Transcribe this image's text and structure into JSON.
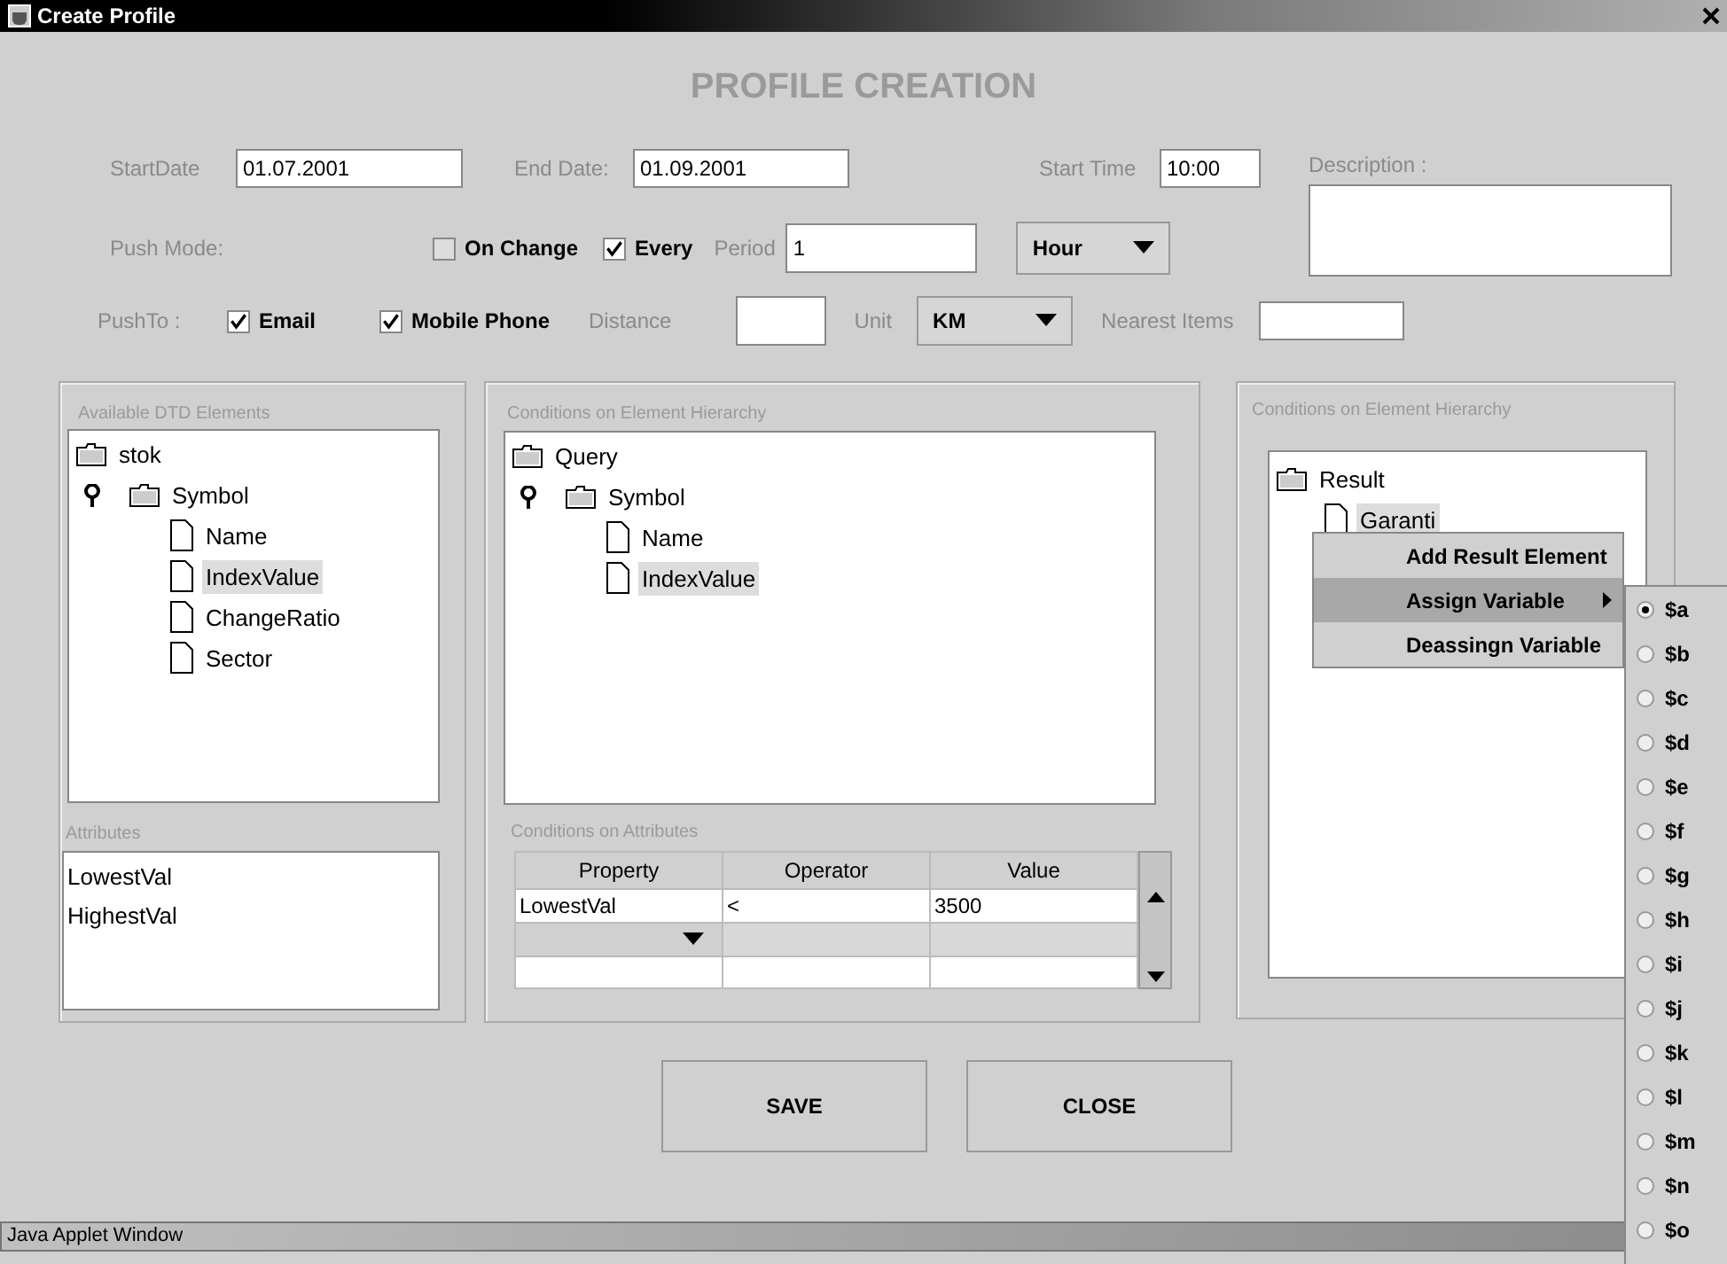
{
  "window": {
    "title": "Create Profile"
  },
  "heading": "PROFILE CREATION",
  "start_date": {
    "label": "StartDate",
    "value": "01.07.2001"
  },
  "end_date": {
    "label": "End Date:",
    "value": "01.09.2001"
  },
  "start_time": {
    "label": "Start Time",
    "value": "10:00"
  },
  "description": {
    "label": "Description :"
  },
  "push_mode": {
    "label": "Push Mode:",
    "options": [
      {
        "label": "On Change",
        "checked": false
      },
      {
        "label": "Every",
        "checked": true
      }
    ],
    "period": {
      "label": "Period",
      "value": "1"
    },
    "period_unit": {
      "value": "Hour"
    }
  },
  "push_to": {
    "label": "PushTo :",
    "options": [
      {
        "label": "Email",
        "checked": true
      },
      {
        "label": "Mobile Phone",
        "checked": true
      }
    ],
    "distance": {
      "label": "Distance"
    },
    "unit": {
      "label": "Unit",
      "value": "KM"
    },
    "nearest_items": {
      "label": "Nearest Items"
    }
  },
  "dtd_panel": {
    "title": "Available DTD Elements",
    "tree": [
      {
        "label": "stok",
        "kind": "folder",
        "selected": false,
        "children": [
          {
            "label": "Symbol",
            "kind": "folder",
            "expanded": true,
            "selected": false,
            "children": [
              {
                "label": "Name",
                "kind": "leaf",
                "selected": false
              },
              {
                "label": "IndexValue",
                "kind": "leaf",
                "selected": true
              },
              {
                "label": "ChangeRatio",
                "kind": "leaf",
                "selected": false
              },
              {
                "label": "Sector",
                "kind": "leaf",
                "selected": false
              }
            ]
          }
        ]
      }
    ],
    "attributes": {
      "title": "Attributes",
      "items": [
        "LowestVal",
        "HighestVal"
      ]
    }
  },
  "hierarchy_panel": {
    "title": "Conditions on Element Hierarchy",
    "tree": [
      {
        "label": "Query",
        "kind": "folder",
        "selected": false,
        "children": [
          {
            "label": "Symbol",
            "kind": "folder",
            "expanded": true,
            "selected": false,
            "children": [
              {
                "label": "Name",
                "kind": "leaf",
                "selected": false
              },
              {
                "label": "IndexValue",
                "kind": "leaf",
                "selected": true
              }
            ]
          }
        ]
      }
    ],
    "attribute_conditions": {
      "title": "Conditions on Attributes",
      "columns": [
        "Property",
        "Operator",
        "Value"
      ],
      "rows": [
        {
          "kind": "text",
          "cells": [
            "LowestVal",
            "<",
            "3500"
          ]
        },
        {
          "kind": "editing",
          "cells": []
        },
        {
          "kind": "empty",
          "cells": []
        }
      ]
    }
  },
  "result_panel": {
    "title": "Conditions on Element Hierarchy",
    "tree": [
      {
        "label": "Result",
        "kind": "folder",
        "selected": false,
        "children": [
          {
            "label": "Garanti",
            "kind": "leaf",
            "selected": true
          }
        ]
      }
    ]
  },
  "context_menu": {
    "items": [
      {
        "label": "Add Result Element",
        "selected": false,
        "submenu": false
      },
      {
        "label": "Assign Variable",
        "selected": true,
        "submenu": true
      },
      {
        "label": "Deassingn Variable",
        "selected": false,
        "submenu": false
      }
    ]
  },
  "variable_menu": {
    "items": [
      {
        "label": "$a",
        "selected": true
      },
      {
        "label": "$b",
        "selected": false
      },
      {
        "label": "$c",
        "selected": false
      },
      {
        "label": "$d",
        "selected": false
      },
      {
        "label": "$e",
        "selected": false
      },
      {
        "label": "$f",
        "selected": false
      },
      {
        "label": "$g",
        "selected": false
      },
      {
        "label": "$h",
        "selected": false
      },
      {
        "label": "$i",
        "selected": false
      },
      {
        "label": "$j",
        "selected": false
      },
      {
        "label": "$k",
        "selected": false
      },
      {
        "label": "$l",
        "selected": false
      },
      {
        "label": "$m",
        "selected": false
      },
      {
        "label": "$n",
        "selected": false
      },
      {
        "label": "$o",
        "selected": false
      }
    ]
  },
  "buttons": [
    "SAVE",
    "CLOSE"
  ],
  "status_bar": "Java Applet Window"
}
